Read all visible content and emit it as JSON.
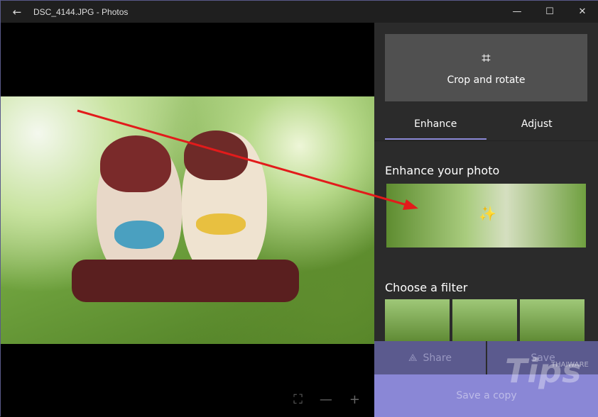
{
  "titlebar": {
    "title": "DSC_4144.JPG - Photos",
    "back_icon": "arrow-left-icon"
  },
  "panel": {
    "crop_label": "Crop and rotate",
    "tabs": [
      {
        "label": "Enhance",
        "active": true
      },
      {
        "label": "Adjust",
        "active": false
      }
    ],
    "enhance_heading": "Enhance your photo",
    "filter_heading": "Choose a filter",
    "share_label": "Share",
    "save_label": "Save",
    "save_copy_label": "Save a copy"
  },
  "watermark": {
    "brand": "Tips",
    "sub": "THAIWARE"
  },
  "colors": {
    "accent": "#8a87d6",
    "annotation": "#e21b1b"
  }
}
